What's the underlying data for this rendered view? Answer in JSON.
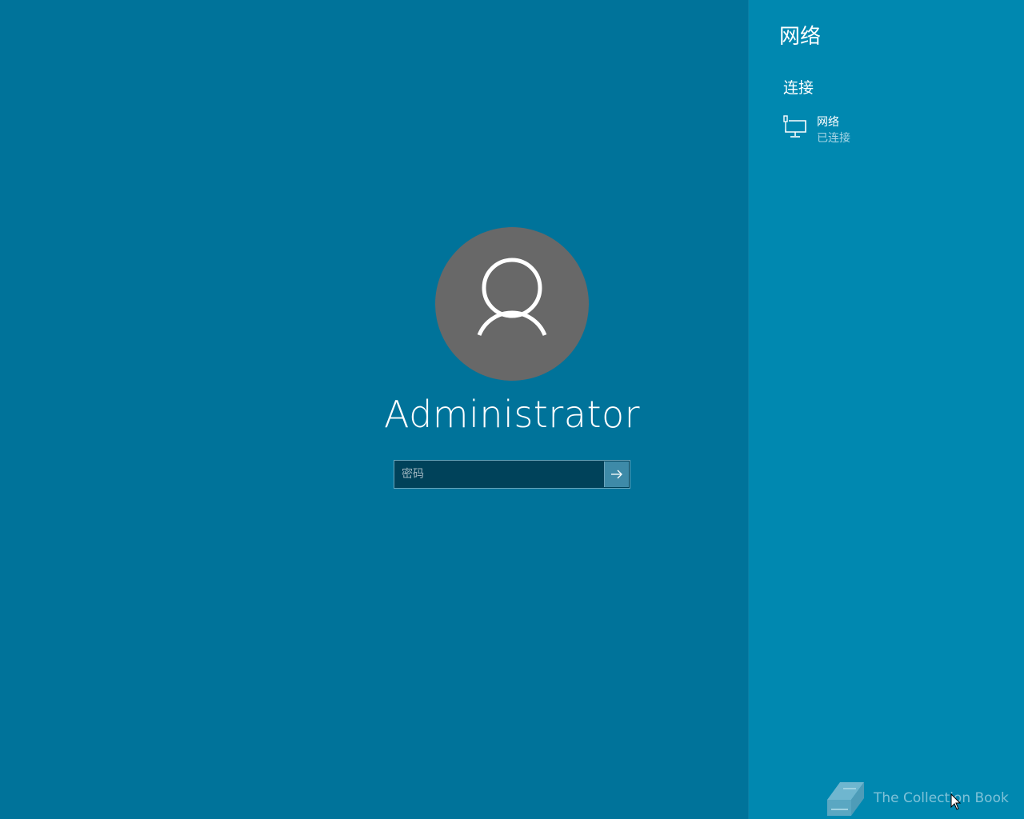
{
  "login": {
    "username": "Administrator",
    "password_placeholder": "密码",
    "password_value": ""
  },
  "network_panel": {
    "title": "网络",
    "section_title": "连接",
    "connections": [
      {
        "name": "网络",
        "status": "已连接",
        "icon": "wired-network-icon"
      }
    ]
  },
  "watermark": {
    "text": "The Collection Book",
    "icon": "book-icon"
  },
  "colors": {
    "background": "#00739a",
    "panel": "#0088b0",
    "avatar": "#686868",
    "password_field": "#00425a",
    "submit_button": "#3e8aa8"
  }
}
